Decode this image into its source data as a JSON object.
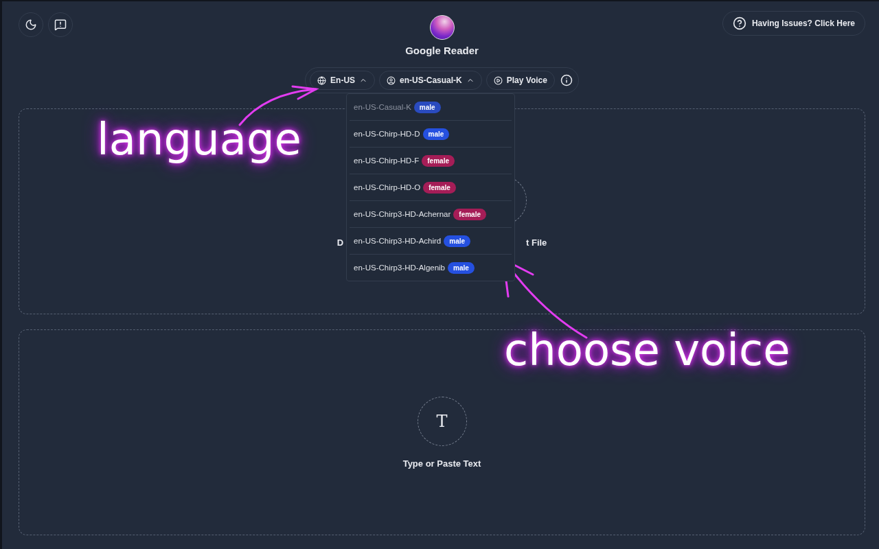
{
  "app": {
    "title": "Google Reader"
  },
  "help_button": {
    "label": "Having Issues? Click Here"
  },
  "toolbar": {
    "language": {
      "label": "En-US",
      "expanded": true
    },
    "voice": {
      "label": "en-US-Casual-K",
      "expanded": true
    },
    "play": {
      "label": "Play Voice"
    }
  },
  "voice_menu": [
    {
      "name": "en-US-Casual-K",
      "tag": "male",
      "color": "#2a4bbf",
      "selected": true
    },
    {
      "name": "en-US-Chirp-HD-D",
      "tag": "male",
      "color": "#2550e0",
      "selected": false
    },
    {
      "name": "en-US-Chirp-HD-F",
      "tag": "female",
      "color": "#a51d57",
      "selected": false
    },
    {
      "name": "en-US-Chirp-HD-O",
      "tag": "female",
      "color": "#a51d57",
      "selected": false
    },
    {
      "name": "en-US-Chirp3-HD-Achernar",
      "tag": "female",
      "color": "#a51d57",
      "selected": false
    },
    {
      "name": "en-US-Chirp3-HD-Achird",
      "tag": "male",
      "color": "#2550e0",
      "selected": false
    },
    {
      "name": "en-US-Chirp3-HD-Algenib",
      "tag": "male",
      "color": "#2550e0",
      "selected": false
    }
  ],
  "upload_zone": {
    "label_start": "D",
    "label_end": "t File"
  },
  "text_zone": {
    "icon_letter": "T",
    "label": "Type or Paste Text"
  },
  "annotations": [
    {
      "text": "language"
    },
    {
      "text": "choose voice"
    }
  ]
}
